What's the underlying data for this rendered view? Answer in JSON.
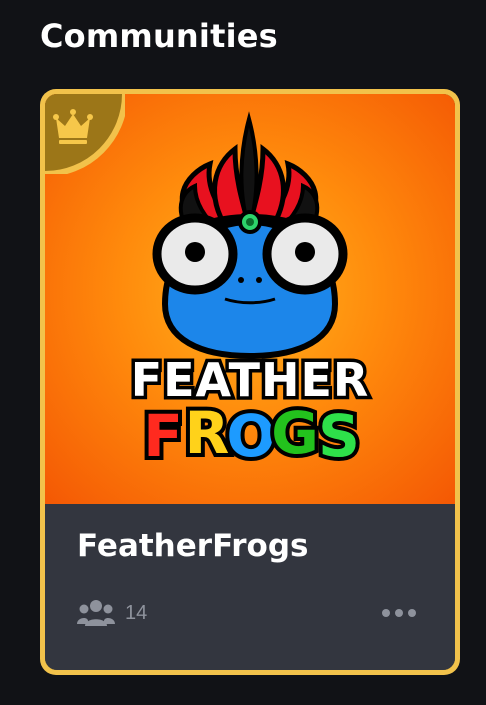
{
  "section": {
    "title": "Communities"
  },
  "card": {
    "name": "FeatherFrogs",
    "members_icon": "users-icon",
    "members_count": "14",
    "more_icon": "more-horizontal-icon",
    "badge_icon": "crown-icon",
    "banner": {
      "logo_line1": "FEATHER",
      "logo_line2_letters": [
        "F",
        "R",
        "O",
        "G",
        "S"
      ],
      "logo_line2_colors": [
        "#ff2a1f",
        "#ffd21a",
        "#1d9bff",
        "#23c21d",
        "#2ee04a"
      ]
    }
  },
  "colors": {
    "page_background": "#111216",
    "card_border": "#f2c24b",
    "card_footer": "#33363f",
    "badge": "#9c7618",
    "muted_text": "#8e929c"
  }
}
